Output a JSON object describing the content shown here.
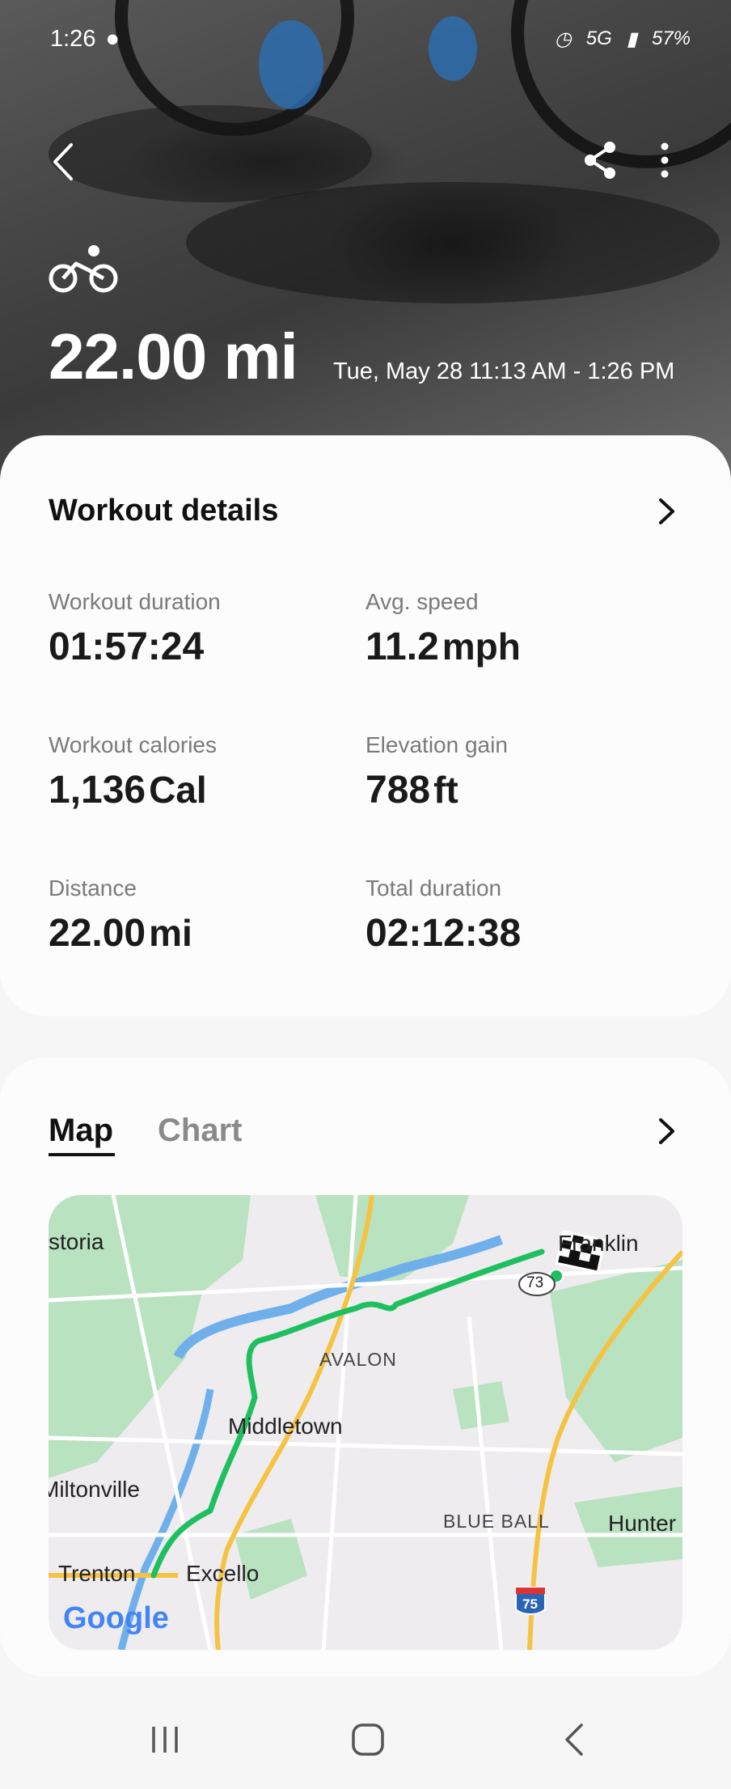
{
  "status_bar": {
    "time": "1:26",
    "network": "5G",
    "battery": "57%"
  },
  "hero": {
    "activity_icon": "cycling-icon",
    "distance": "22.00 mi",
    "date_range": "Tue, May 28 11:13 AM - 1:26 PM"
  },
  "details": {
    "title": "Workout details",
    "metrics": [
      {
        "label": "Workout duration",
        "value": "01:57:24",
        "unit": ""
      },
      {
        "label": "Avg. speed",
        "value": "11.2",
        "unit": "mph"
      },
      {
        "label": "Workout calories",
        "value": "1,136",
        "unit": "Cal"
      },
      {
        "label": "Elevation gain",
        "value": "788",
        "unit": "ft"
      },
      {
        "label": "Distance",
        "value": "22.00",
        "unit": "mi"
      },
      {
        "label": "Total duration",
        "value": "02:12:38",
        "unit": ""
      }
    ]
  },
  "map_section": {
    "tabs": [
      "Map",
      "Chart"
    ],
    "active_tab": "Map",
    "places": [
      "storia",
      "Franklin",
      "AVALON",
      "Middletown",
      "Miltonville",
      "BLUE BALL",
      "Hunter",
      "Trenton",
      "Excello"
    ],
    "route_shields": [
      "73",
      "75"
    ],
    "attribution": "Google"
  },
  "colors": {
    "route": "#1fbf5f",
    "accent_green": "#c8e6c9",
    "road": "#f5c242"
  }
}
